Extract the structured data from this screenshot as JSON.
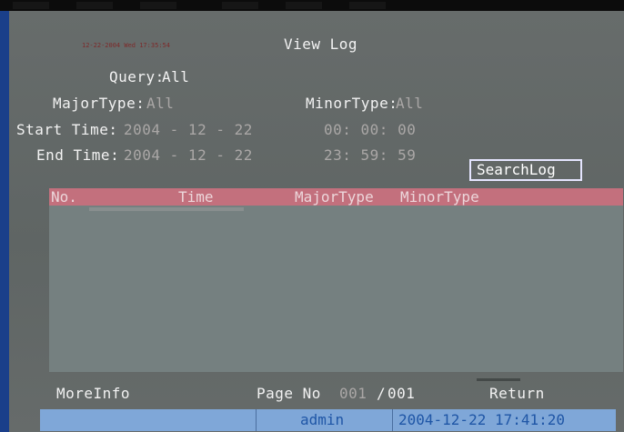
{
  "header": {
    "timestamp_small": "12-22-2004 Wed 17:35:54",
    "title": "View Log"
  },
  "query": {
    "label": "Query:",
    "value": "All"
  },
  "major_type": {
    "label": "MajorType:",
    "value": "All"
  },
  "minor_type": {
    "label": "MinorType:",
    "value": "All"
  },
  "start_time": {
    "label": "Start Time:",
    "date": "2004 - 12 - 22",
    "time": "00: 00: 00"
  },
  "end_time": {
    "label": "End Time:",
    "date": "2004 - 12 - 22",
    "time": "23: 59: 59"
  },
  "search_button": {
    "label": "SearchLog"
  },
  "log_table": {
    "columns": [
      "No.",
      "Time",
      "MajorType",
      "MinorType"
    ],
    "rows": []
  },
  "footer": {
    "more_info": "MoreInfo",
    "page_label": "Page No",
    "page_current": "001",
    "page_sep": "/",
    "page_total": "001",
    "return_label": "Return"
  },
  "status_bar": {
    "user": "admin",
    "datetime": "2004-12-22 17:41:20"
  },
  "colors": {
    "panel_bg": "#646968",
    "text_active": "#f2f2f2",
    "text_dim": "#aaa7a6",
    "header_bar": "#c3707d",
    "list_bg": "#758080",
    "status_bg": "#7fa7d8",
    "status_text": "#1f56a6",
    "edge_blue": "#1a3f8a"
  }
}
